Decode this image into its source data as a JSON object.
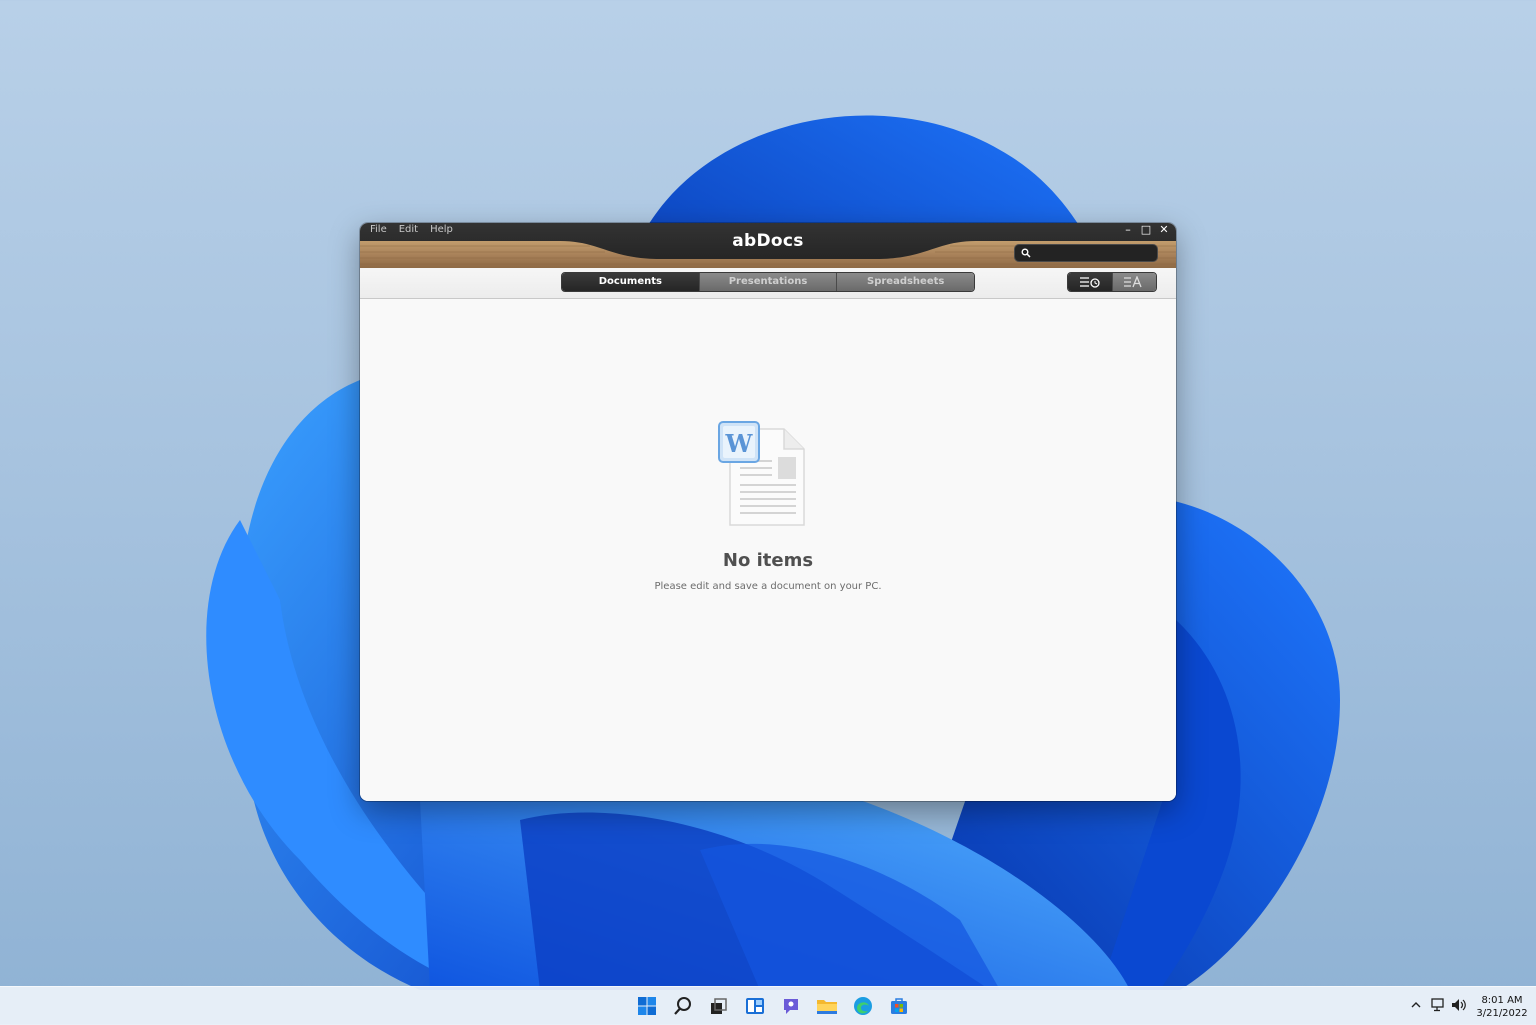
{
  "window": {
    "title": "abDocs",
    "menu": [
      "File",
      "Edit",
      "Help"
    ],
    "controls": {
      "minimize": "–",
      "maximize": "□",
      "close": "✕"
    },
    "search_placeholder": ""
  },
  "tabs": [
    {
      "label": "Documents",
      "selected": true
    },
    {
      "label": "Presentations",
      "selected": false
    },
    {
      "label": "Spreadsheets",
      "selected": false
    }
  ],
  "sort_buttons": [
    {
      "icon": "sort-by-date-icon",
      "selected": true
    },
    {
      "icon": "sort-by-name-icon",
      "selected": false
    }
  ],
  "empty_state": {
    "icon": "word-document-icon",
    "icon_letter": "W",
    "title": "No items",
    "subtitle": "Please edit and save a document on your PC."
  },
  "taskbar": {
    "apps": [
      "windows-start-icon",
      "search-icon",
      "task-view-icon",
      "widgets-icon",
      "chat-icon",
      "file-explorer-icon",
      "edge-icon",
      "store-icon"
    ],
    "tray": [
      "chevron-up-icon",
      "network-icon",
      "volume-icon"
    ],
    "time": "8:01 AM",
    "date": "3/21/2022"
  },
  "colors": {
    "wood": "#b08a5c",
    "titlebar": "#2a2a2a",
    "accent_blue": "#0a5bd6"
  }
}
